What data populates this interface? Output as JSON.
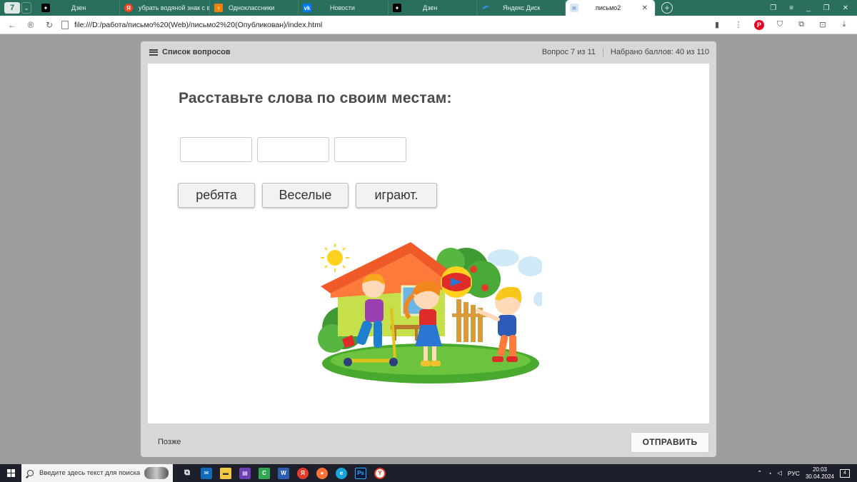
{
  "browser": {
    "tab_counter": "7",
    "tabs": [
      {
        "label": "Дзен",
        "icon": "dzen-icon",
        "color": "#000000"
      },
      {
        "label": "убрать водяной знак с ви",
        "icon": "yandex-icon",
        "color": "#fc3f1d"
      },
      {
        "label": "Одноклассники",
        "icon": "ok-icon",
        "color": "#ee8208"
      },
      {
        "label": "Новости",
        "icon": "vk-icon",
        "color": "#0077ff"
      },
      {
        "label": "Дзен",
        "icon": "dzen-icon",
        "color": "#000000"
      },
      {
        "label": "Яндекс Диск",
        "icon": "disk-icon",
        "color": "#3a8ee6"
      },
      {
        "label": "письмо2",
        "icon": "page-icon",
        "color": "#5a86c9"
      }
    ],
    "url": "file:///D:/работа/письмо%20(Web)/письмо2%20(Опубликован)/index.html"
  },
  "quiz": {
    "question_list_label": "Список вопросов",
    "progress": "Вопрос 7 из 11",
    "score": "Набрано баллов: 40 из 110",
    "question": "Расставьте слова по своим местам:",
    "words": [
      "ребята",
      "Веселые",
      "играют."
    ],
    "later_label": "Позже",
    "submit_label": "ОТПРАВИТЬ"
  },
  "taskbar": {
    "search_placeholder": "Введите здесь текст для поиска",
    "language": "РУС",
    "time": "20:03",
    "date": "30.04.2024",
    "notification_count": "4"
  }
}
